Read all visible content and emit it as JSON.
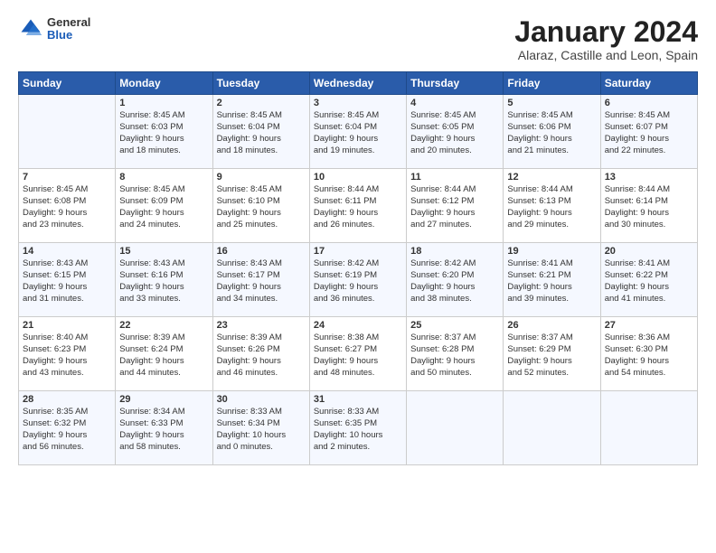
{
  "header": {
    "logo_general": "General",
    "logo_blue": "Blue",
    "month": "January 2024",
    "location": "Alaraz, Castille and Leon, Spain"
  },
  "days_of_week": [
    "Sunday",
    "Monday",
    "Tuesday",
    "Wednesday",
    "Thursday",
    "Friday",
    "Saturday"
  ],
  "weeks": [
    [
      {
        "day": "",
        "sunrise": "",
        "sunset": "",
        "daylight": ""
      },
      {
        "day": "1",
        "sunrise": "Sunrise: 8:45 AM",
        "sunset": "Sunset: 6:03 PM",
        "daylight": "Daylight: 9 hours and 18 minutes."
      },
      {
        "day": "2",
        "sunrise": "Sunrise: 8:45 AM",
        "sunset": "Sunset: 6:04 PM",
        "daylight": "Daylight: 9 hours and 18 minutes."
      },
      {
        "day": "3",
        "sunrise": "Sunrise: 8:45 AM",
        "sunset": "Sunset: 6:04 PM",
        "daylight": "Daylight: 9 hours and 19 minutes."
      },
      {
        "day": "4",
        "sunrise": "Sunrise: 8:45 AM",
        "sunset": "Sunset: 6:05 PM",
        "daylight": "Daylight: 9 hours and 20 minutes."
      },
      {
        "day": "5",
        "sunrise": "Sunrise: 8:45 AM",
        "sunset": "Sunset: 6:06 PM",
        "daylight": "Daylight: 9 hours and 21 minutes."
      },
      {
        "day": "6",
        "sunrise": "Sunrise: 8:45 AM",
        "sunset": "Sunset: 6:07 PM",
        "daylight": "Daylight: 9 hours and 22 minutes."
      }
    ],
    [
      {
        "day": "7",
        "sunrise": "Sunrise: 8:45 AM",
        "sunset": "Sunset: 6:08 PM",
        "daylight": "Daylight: 9 hours and 23 minutes."
      },
      {
        "day": "8",
        "sunrise": "Sunrise: 8:45 AM",
        "sunset": "Sunset: 6:09 PM",
        "daylight": "Daylight: 9 hours and 24 minutes."
      },
      {
        "day": "9",
        "sunrise": "Sunrise: 8:45 AM",
        "sunset": "Sunset: 6:10 PM",
        "daylight": "Daylight: 9 hours and 25 minutes."
      },
      {
        "day": "10",
        "sunrise": "Sunrise: 8:44 AM",
        "sunset": "Sunset: 6:11 PM",
        "daylight": "Daylight: 9 hours and 26 minutes."
      },
      {
        "day": "11",
        "sunrise": "Sunrise: 8:44 AM",
        "sunset": "Sunset: 6:12 PM",
        "daylight": "Daylight: 9 hours and 27 minutes."
      },
      {
        "day": "12",
        "sunrise": "Sunrise: 8:44 AM",
        "sunset": "Sunset: 6:13 PM",
        "daylight": "Daylight: 9 hours and 29 minutes."
      },
      {
        "day": "13",
        "sunrise": "Sunrise: 8:44 AM",
        "sunset": "Sunset: 6:14 PM",
        "daylight": "Daylight: 9 hours and 30 minutes."
      }
    ],
    [
      {
        "day": "14",
        "sunrise": "Sunrise: 8:43 AM",
        "sunset": "Sunset: 6:15 PM",
        "daylight": "Daylight: 9 hours and 31 minutes."
      },
      {
        "day": "15",
        "sunrise": "Sunrise: 8:43 AM",
        "sunset": "Sunset: 6:16 PM",
        "daylight": "Daylight: 9 hours and 33 minutes."
      },
      {
        "day": "16",
        "sunrise": "Sunrise: 8:43 AM",
        "sunset": "Sunset: 6:17 PM",
        "daylight": "Daylight: 9 hours and 34 minutes."
      },
      {
        "day": "17",
        "sunrise": "Sunrise: 8:42 AM",
        "sunset": "Sunset: 6:19 PM",
        "daylight": "Daylight: 9 hours and 36 minutes."
      },
      {
        "day": "18",
        "sunrise": "Sunrise: 8:42 AM",
        "sunset": "Sunset: 6:20 PM",
        "daylight": "Daylight: 9 hours and 38 minutes."
      },
      {
        "day": "19",
        "sunrise": "Sunrise: 8:41 AM",
        "sunset": "Sunset: 6:21 PM",
        "daylight": "Daylight: 9 hours and 39 minutes."
      },
      {
        "day": "20",
        "sunrise": "Sunrise: 8:41 AM",
        "sunset": "Sunset: 6:22 PM",
        "daylight": "Daylight: 9 hours and 41 minutes."
      }
    ],
    [
      {
        "day": "21",
        "sunrise": "Sunrise: 8:40 AM",
        "sunset": "Sunset: 6:23 PM",
        "daylight": "Daylight: 9 hours and 43 minutes."
      },
      {
        "day": "22",
        "sunrise": "Sunrise: 8:39 AM",
        "sunset": "Sunset: 6:24 PM",
        "daylight": "Daylight: 9 hours and 44 minutes."
      },
      {
        "day": "23",
        "sunrise": "Sunrise: 8:39 AM",
        "sunset": "Sunset: 6:26 PM",
        "daylight": "Daylight: 9 hours and 46 minutes."
      },
      {
        "day": "24",
        "sunrise": "Sunrise: 8:38 AM",
        "sunset": "Sunset: 6:27 PM",
        "daylight": "Daylight: 9 hours and 48 minutes."
      },
      {
        "day": "25",
        "sunrise": "Sunrise: 8:37 AM",
        "sunset": "Sunset: 6:28 PM",
        "daylight": "Daylight: 9 hours and 50 minutes."
      },
      {
        "day": "26",
        "sunrise": "Sunrise: 8:37 AM",
        "sunset": "Sunset: 6:29 PM",
        "daylight": "Daylight: 9 hours and 52 minutes."
      },
      {
        "day": "27",
        "sunrise": "Sunrise: 8:36 AM",
        "sunset": "Sunset: 6:30 PM",
        "daylight": "Daylight: 9 hours and 54 minutes."
      }
    ],
    [
      {
        "day": "28",
        "sunrise": "Sunrise: 8:35 AM",
        "sunset": "Sunset: 6:32 PM",
        "daylight": "Daylight: 9 hours and 56 minutes."
      },
      {
        "day": "29",
        "sunrise": "Sunrise: 8:34 AM",
        "sunset": "Sunset: 6:33 PM",
        "daylight": "Daylight: 9 hours and 58 minutes."
      },
      {
        "day": "30",
        "sunrise": "Sunrise: 8:33 AM",
        "sunset": "Sunset: 6:34 PM",
        "daylight": "Daylight: 10 hours and 0 minutes."
      },
      {
        "day": "31",
        "sunrise": "Sunrise: 8:33 AM",
        "sunset": "Sunset: 6:35 PM",
        "daylight": "Daylight: 10 hours and 2 minutes."
      },
      {
        "day": "",
        "sunrise": "",
        "sunset": "",
        "daylight": ""
      },
      {
        "day": "",
        "sunrise": "",
        "sunset": "",
        "daylight": ""
      },
      {
        "day": "",
        "sunrise": "",
        "sunset": "",
        "daylight": ""
      }
    ]
  ]
}
